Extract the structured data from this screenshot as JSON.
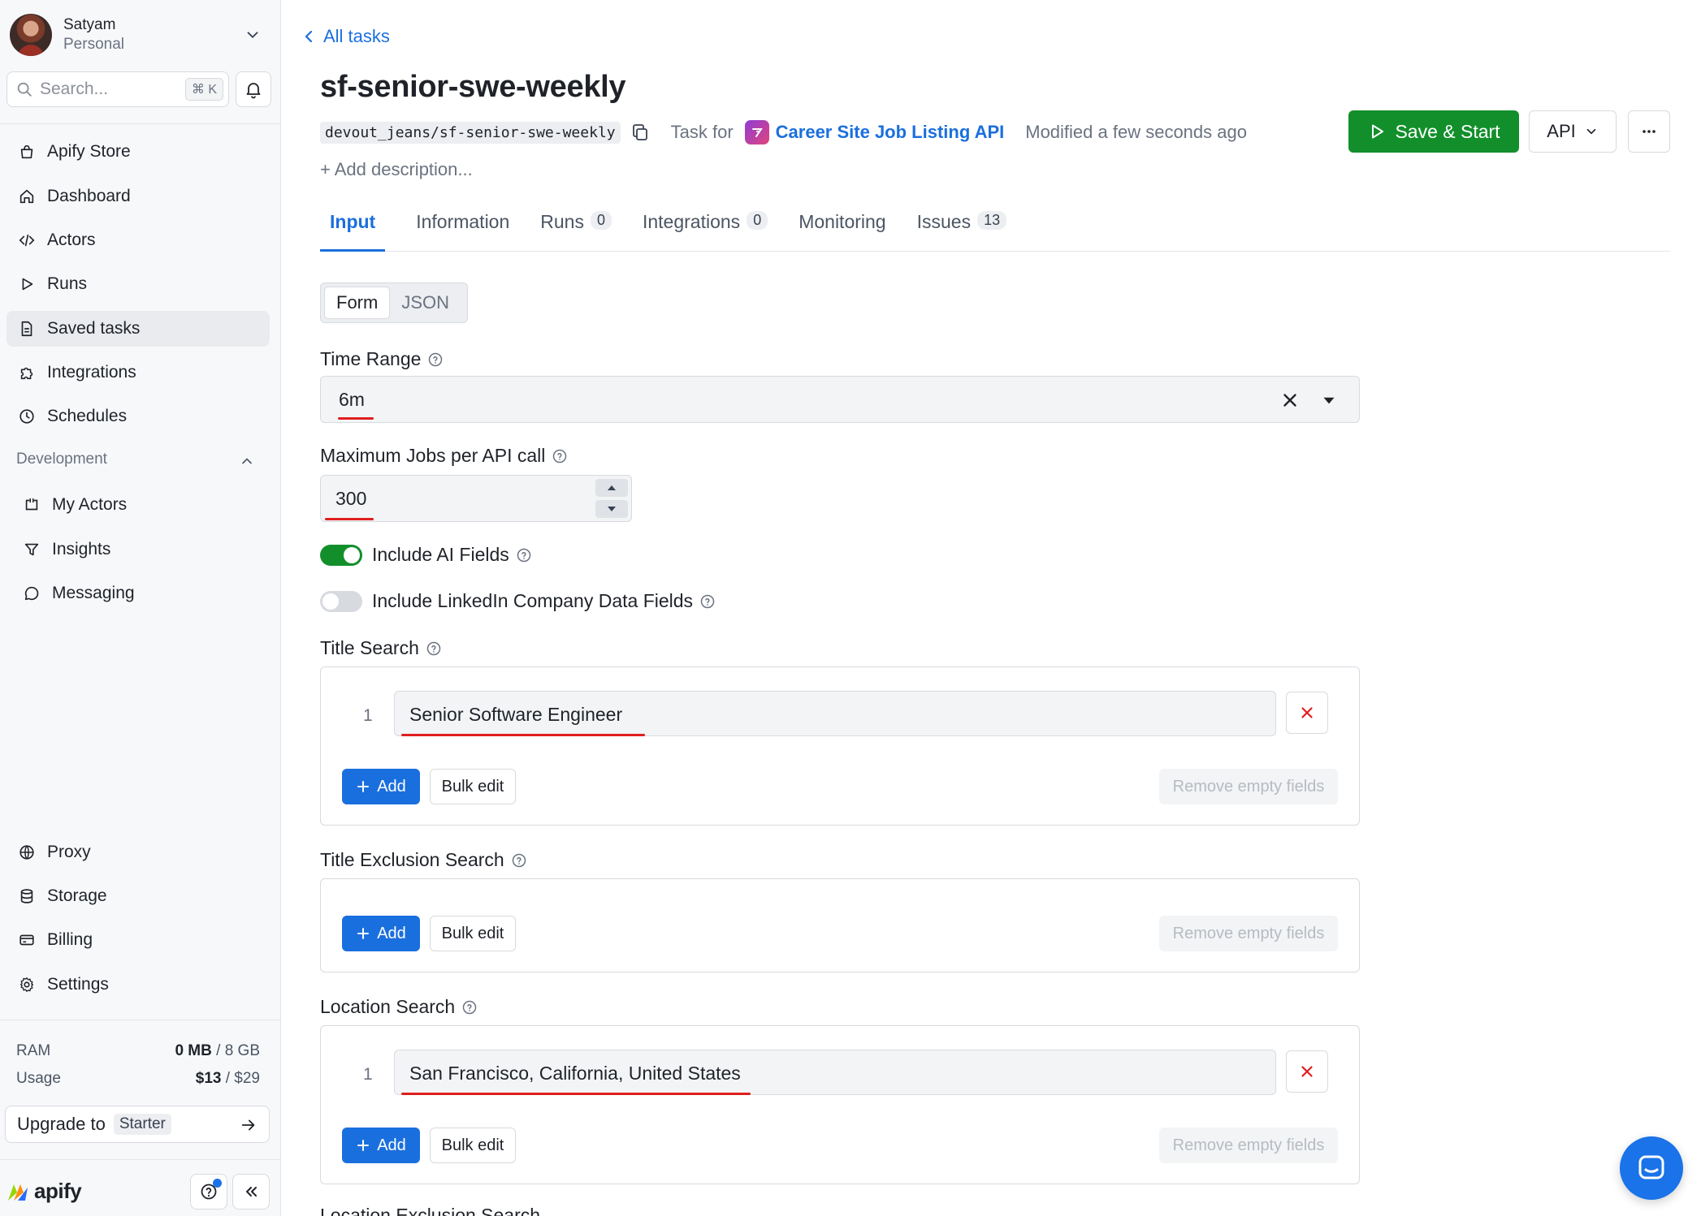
{
  "user": {
    "name": "Satyam",
    "plan": "Personal"
  },
  "search": {
    "placeholder": "Search...",
    "shortcut": "⌘ K"
  },
  "nav": {
    "items": [
      {
        "label": "Apify Store",
        "icon": "bag-icon"
      },
      {
        "label": "Dashboard",
        "icon": "home-icon"
      },
      {
        "label": "Actors",
        "icon": "code-icon"
      },
      {
        "label": "Runs",
        "icon": "play-icon"
      },
      {
        "label": "Saved tasks",
        "icon": "document-icon",
        "active": true
      },
      {
        "label": "Integrations",
        "icon": "puzzle-icon"
      },
      {
        "label": "Schedules",
        "icon": "clock-icon"
      }
    ],
    "development_title": "Development",
    "development_items": [
      {
        "label": "My Actors",
        "icon": "actor-icon"
      },
      {
        "label": "Insights",
        "icon": "filter-icon"
      },
      {
        "label": "Messaging",
        "icon": "chat-icon"
      }
    ],
    "bottom_items": [
      {
        "label": "Proxy",
        "icon": "globe-icon"
      },
      {
        "label": "Storage",
        "icon": "database-icon"
      },
      {
        "label": "Billing",
        "icon": "card-icon"
      },
      {
        "label": "Settings",
        "icon": "gear-icon"
      }
    ]
  },
  "usage": {
    "ram_label": "RAM",
    "ram_used": "0 MB",
    "ram_total": " / 8 GB",
    "usage_label": "Usage",
    "usage_used": "$13",
    "usage_total": " / $29"
  },
  "upgrade": {
    "label": "Upgrade to",
    "plan": "Starter"
  },
  "brand": {
    "name": "apify"
  },
  "header": {
    "back_label": "All tasks",
    "title": "sf-senior-swe-weekly",
    "slug": "devout_jeans/sf-senior-swe-weekly",
    "task_for": "Task for",
    "actor_name": "Career Site Job Listing API",
    "modified": "Modified a few seconds ago",
    "add_description": "+ Add description...",
    "save_start": "Save & Start",
    "api": "API"
  },
  "tabs": [
    {
      "label": "Input",
      "active": true
    },
    {
      "label": "Information"
    },
    {
      "label": "Runs",
      "count": "0"
    },
    {
      "label": "Integrations",
      "count": "0"
    },
    {
      "label": "Monitoring"
    },
    {
      "label": "Issues",
      "count": "13"
    }
  ],
  "mode": {
    "form": "Form",
    "json": "JSON"
  },
  "fields": {
    "time_range": {
      "label": "Time Range",
      "value": "6m"
    },
    "max_jobs": {
      "label": "Maximum Jobs per API call",
      "value": "300"
    },
    "include_ai": {
      "label": "Include AI Fields",
      "enabled": true
    },
    "include_linkedin": {
      "label": "Include LinkedIn Company Data Fields",
      "enabled": false
    },
    "title_search": {
      "label": "Title Search",
      "items": [
        "Senior Software Engineer"
      ]
    },
    "title_exclusion": {
      "label": "Title Exclusion Search",
      "items": []
    },
    "location_search": {
      "label": "Location Search",
      "items": [
        "San Francisco, California, United States"
      ]
    },
    "location_exclusion": {
      "label": "Location Exclusion Search"
    }
  },
  "array_buttons": {
    "add": "Add",
    "bulk": "Bulk edit",
    "remove_empty": "Remove empty fields"
  },
  "row_index_1": "1",
  "colors": {
    "accent": "#1a6fde",
    "primary_green": "#128f2b",
    "highlight_red": "#e01e1e"
  }
}
